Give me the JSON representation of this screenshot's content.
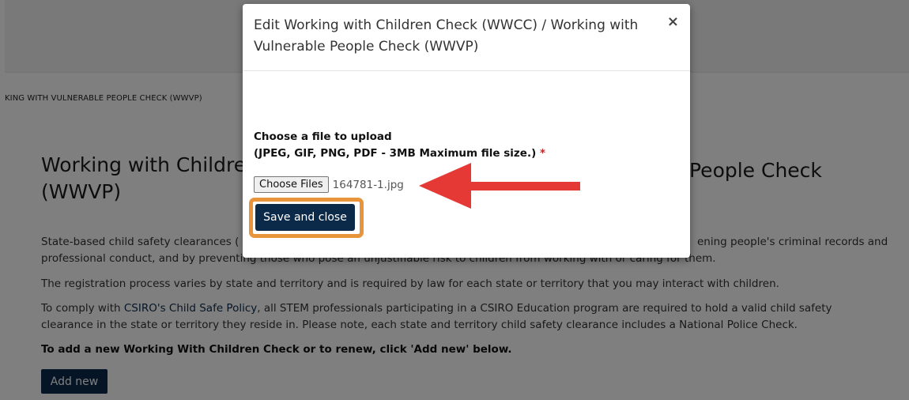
{
  "page": {
    "breadcrumb": "KING WITH VULNERABLE PEOPLE CHECK (WWVP)",
    "title_line1": "Working with Childre",
    "title_line2": "(WWVP)",
    "title_right": "People Check",
    "paragraph1_left": "State-based child safety clearances (",
    "paragraph1_right": "ening people's criminal records and",
    "paragraph1_line2": "professional conduct, and by preventing those who pose an unjustifiable risk to children from working with or caring for them.",
    "paragraph2": "The registration process varies by state and territory and is required by law for each state or territory that you may interact with children.",
    "paragraph3_prefix": "To comply with ",
    "paragraph3_link": "CSIRO's Child Safe Policy",
    "paragraph3_suffix": ", all STEM professionals participating in a CSIRO Education program are required to hold a valid child safety",
    "paragraph3_line2": "clearance in the state or territory they reside in. Please note, each state and territory child safety clearance includes a National Police Check.",
    "callout": "To add a new Working With Children Check or to renew, click 'Add new' below.",
    "add_new_label": "Add new"
  },
  "modal": {
    "title": "Edit Working with Children Check (WWCC) / Working with Vulnerable People Check (WWVP)",
    "close_glyph": "×",
    "upload_label_line1": "Choose a file to upload",
    "upload_label_line2": "(JPEG, GIF, PNG, PDF - 3MB Maximum file size.)",
    "required_marker": "*",
    "file_button_label": "Choose Files",
    "file_name": "164781-1.jpg",
    "save_label": "Save and close"
  },
  "colors": {
    "accent_navy": "#0b2a4a",
    "highlight_orange": "#e8943a",
    "annotation_red": "#e53935"
  }
}
